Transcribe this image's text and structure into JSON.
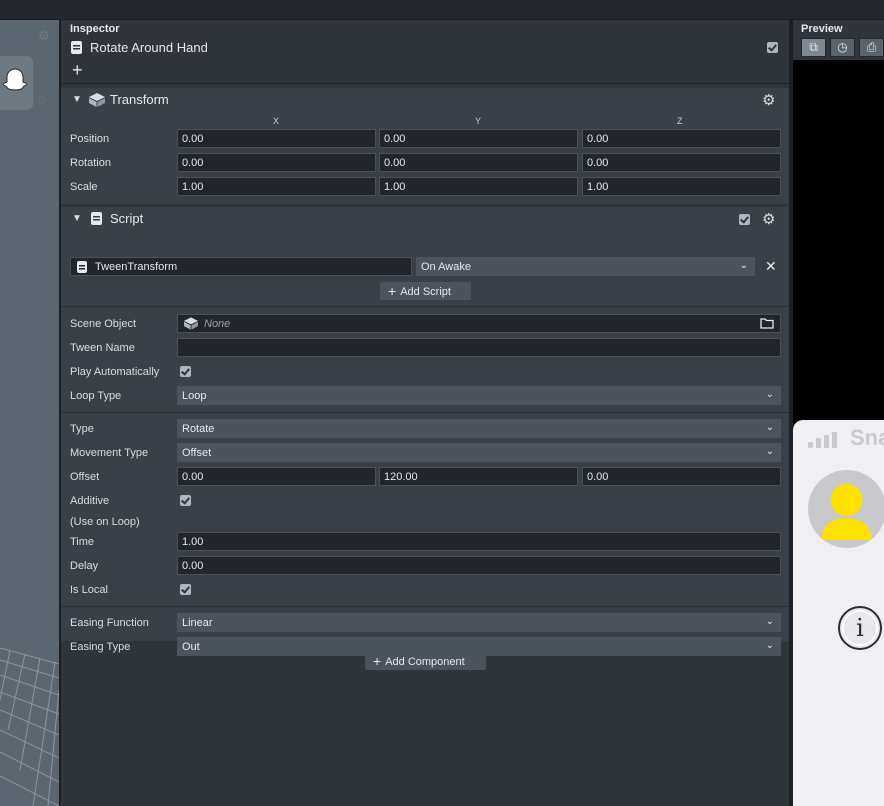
{
  "inspector": {
    "title": "Inspector",
    "object_name": "Rotate Around Hand",
    "add_glyph": "+"
  },
  "transform": {
    "title": "Transform",
    "axes": [
      "X",
      "Y",
      "Z"
    ],
    "rows": [
      {
        "label": "Position",
        "values": [
          "0.00",
          "0.00",
          "0.00"
        ]
      },
      {
        "label": "Rotation",
        "values": [
          "0.00",
          "0.00",
          "0.00"
        ]
      },
      {
        "label": "Scale",
        "values": [
          "1.00",
          "1.00",
          "1.00"
        ]
      }
    ]
  },
  "script": {
    "title": "Script",
    "script_asset": "TweenTransform",
    "event": "On Awake",
    "add_script_label": "Add Script",
    "scene_object_label": "Scene Object",
    "scene_object_value": "None",
    "tween_name_label": "Tween Name",
    "tween_name_value": "",
    "play_auto_label": "Play Automatically",
    "loop_type_label": "Loop Type",
    "loop_type_value": "Loop",
    "type_label": "Type",
    "type_value": "Rotate",
    "movement_type_label": "Movement Type",
    "movement_type_value": "Offset",
    "offset_label": "Offset",
    "offset_values": [
      "0.00",
      "120.00",
      "0.00"
    ],
    "additive_label": "Additive",
    "use_on_loop_label": "(Use on Loop)",
    "time_label": "Time",
    "time_value": "1.00",
    "delay_label": "Delay",
    "delay_value": "0.00",
    "is_local_label": "Is Local",
    "easing_function_label": "Easing Function",
    "easing_function_value": "Linear",
    "easing_type_label": "Easing Type",
    "easing_type_value": "Out"
  },
  "add_component_label": "Add Component",
  "preview": {
    "title": "Preview",
    "snap_text": "Sna"
  },
  "icons": {
    "collapse": "chevron-down-icon",
    "settings": "gear-icon",
    "remove": "close-icon",
    "folder": "folder-icon",
    "object": "cube-icon"
  }
}
